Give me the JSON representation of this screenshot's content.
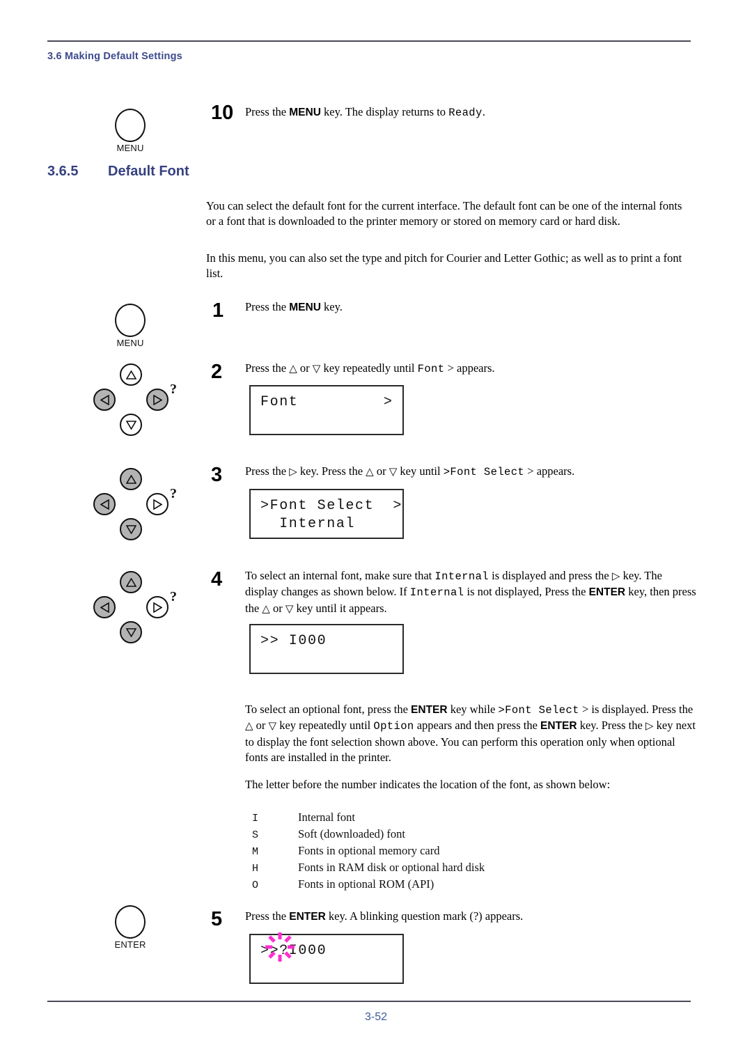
{
  "header": {
    "running_head": "3.6 Making Default Settings"
  },
  "footer": {
    "page_number": "3-52"
  },
  "section": {
    "number": "3.6.5",
    "title": "Default Font"
  },
  "colors": {
    "heading_blue": "#36417f",
    "running_head_blue": "#3d4a8c",
    "page_number_blue": "#3d5a96",
    "key_highlight_gray": "#b3b3b3",
    "blink_magenta": "#ff2fd0"
  },
  "step10": {
    "number": "10",
    "key_label": "MENU",
    "text_a": "Press the ",
    "text_key": "MENU",
    "text_b": " key. The display returns to ",
    "text_mono": "Ready",
    "text_c": "."
  },
  "intro": {
    "para1": "You can select the default font for the current interface. The default font can be one of the internal fonts or a font that is downloaded to the printer memory or stored on memory card or hard disk.",
    "para2": "In this menu, you can also set the type and pitch for Courier and Letter Gothic; as well as to print a font list."
  },
  "step1": {
    "number": "1",
    "key_label": "MENU",
    "text_a": "Press the ",
    "text_key": "MENU",
    "text_b": " key."
  },
  "step2": {
    "number": "2",
    "text_a": "Press the ",
    "up_glyph": "△",
    "text_b": " or ",
    "down_glyph": "▽",
    "text_c": " key repeatedly until ",
    "text_mono": "Font",
    "text_d": " > appears.",
    "keys": {
      "up": false,
      "down": false,
      "left": true,
      "right": true,
      "question": "?"
    },
    "lcd": {
      "line1": "Font         >",
      "line2": ""
    }
  },
  "step3": {
    "number": "3",
    "text_a": "Press the ",
    "right_glyph": "▷",
    "text_b": " key. Press the ",
    "up_glyph": "△",
    "text_c": " or ",
    "down_glyph": "▽",
    "text_d": " key until ",
    "text_mono": ">Font Select",
    "text_e": " > appears.",
    "keys": {
      "up": true,
      "down": true,
      "left": true,
      "right": false,
      "question": "?"
    },
    "lcd": {
      "line1": ">Font Select  >",
      "line2": "  Internal"
    }
  },
  "step4": {
    "number": "4",
    "line1_a": "To select an internal font, make sure that ",
    "line1_mono": "Internal",
    "line1_b": " is displayed and press the ",
    "line1_glyph": "▷",
    "line1_c": " key.",
    "line2_a": "The display changes as shown below. If ",
    "line2_mono": "Internal",
    "line2_b": " is not displayed, Press the ",
    "line2_key": "ENTER",
    "line3_a": "key, then press the ",
    "line3_up": "△",
    "line3_b": " or ",
    "line3_down": "▽",
    "line3_c": " key until it appears.",
    "keys": {
      "up": true,
      "down": true,
      "left": true,
      "right": false,
      "question": "?"
    },
    "lcd": {
      "line1": ">> I000",
      "line2": ""
    }
  },
  "optional_para": {
    "a": "To select an optional font, press the ",
    "key1": "ENTER",
    "b": " key while ",
    "mono1": ">Font Select",
    "c": " > is displayed. Press the ",
    "up": "△",
    "d": " or ",
    "down": "▽",
    "e": " key repeatedly until ",
    "mono2": "Option",
    "f": " appears and then press the ",
    "key2": "ENTER",
    "g": " key. Press the ",
    "right": "▷",
    "h": " key next to display the font selection shown above. You can perform this operation only when optional fonts are installed in the printer."
  },
  "letter_intro": "The letter before the number indicates the location of the font, as shown below:",
  "letter_table": [
    {
      "code": "I",
      "desc": "Internal font"
    },
    {
      "code": "S",
      "desc": "Soft (downloaded) font"
    },
    {
      "code": "M",
      "desc": "Fonts in optional memory card"
    },
    {
      "code": "H",
      "desc": "Fonts in RAM disk or optional hard disk"
    },
    {
      "code": "O",
      "desc": "Fonts in optional ROM (API)"
    }
  ],
  "step5": {
    "number": "5",
    "key_label": "ENTER",
    "text_a": "Press the ",
    "text_key": "ENTER",
    "text_b": " key. A blinking question mark (?) appears.",
    "lcd": {
      "line1": ">>?I000",
      "line2": ""
    }
  }
}
